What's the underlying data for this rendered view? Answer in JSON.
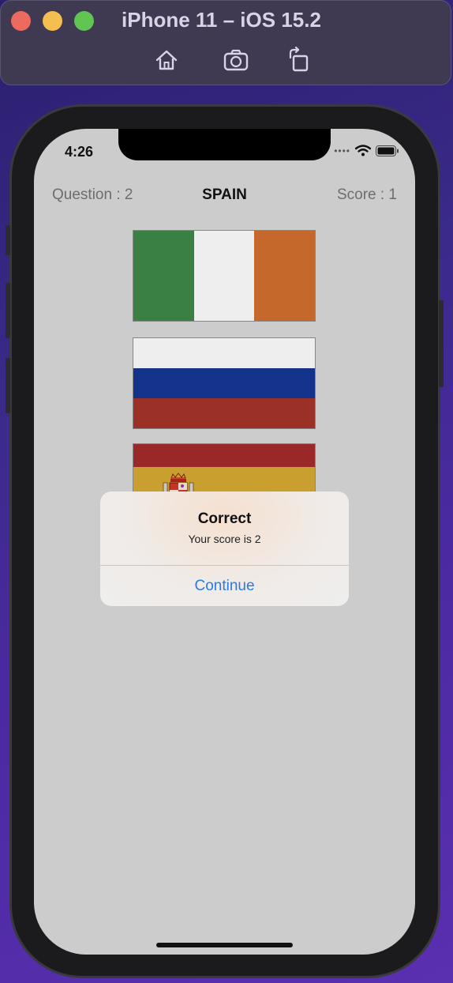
{
  "simulator": {
    "title": "iPhone 11 – iOS 15.2",
    "toolbar_icons": [
      "home-icon",
      "screenshot-icon",
      "rotate-icon"
    ]
  },
  "status_bar": {
    "time": "4:26",
    "icons": [
      "signal-dots-icon",
      "wifi-icon",
      "battery-icon"
    ]
  },
  "header": {
    "question_label": "Question : 2",
    "country": "SPAIN",
    "score_label": "Score : 1"
  },
  "flags": [
    {
      "name": "ireland",
      "colors": [
        "#3a8045",
        "#eeeeee",
        "#c4682b"
      ]
    },
    {
      "name": "russia",
      "colors": [
        "#eeeeee",
        "#14338a",
        "#9b3126"
      ]
    },
    {
      "name": "spain",
      "colors": [
        "#9b2828",
        "#c9a030"
      ]
    }
  ],
  "alert": {
    "title": "Correct",
    "message": "Your score is 2",
    "button": "Continue",
    "button_color": "#2a7ae2"
  },
  "colors": {
    "screen_background": "#cccccc",
    "desktop_background": "#3b2a8a"
  }
}
